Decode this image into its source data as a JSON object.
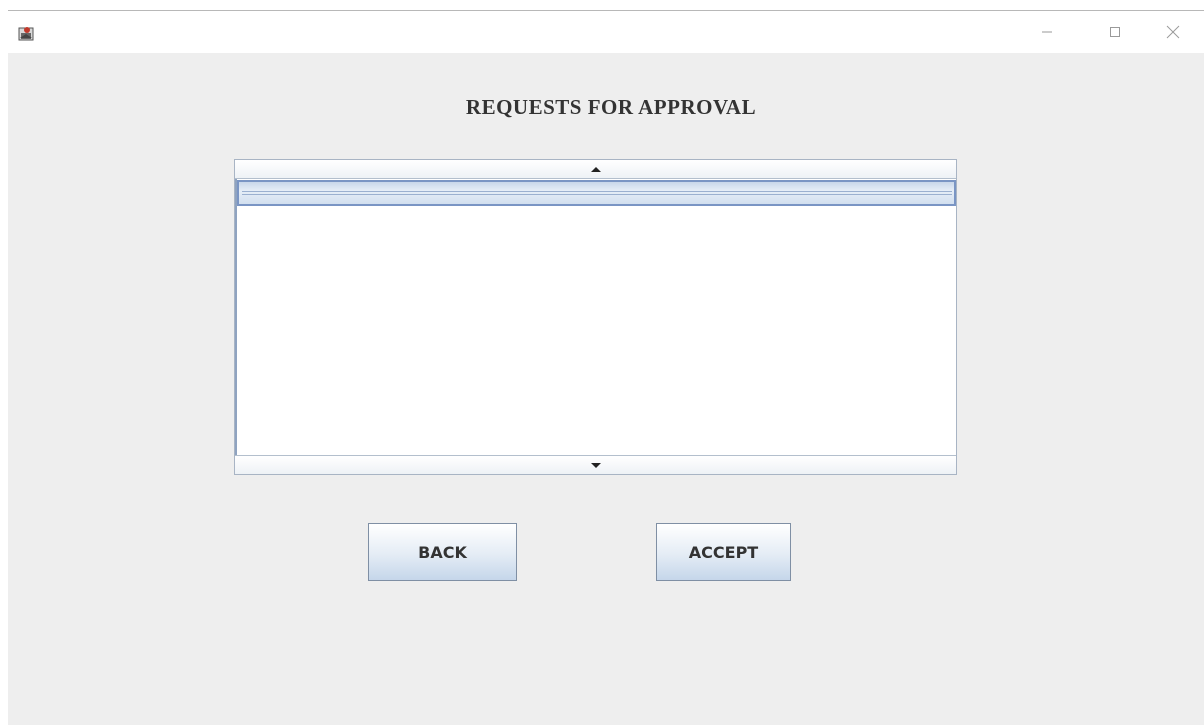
{
  "window": {
    "icon": "java-app-icon",
    "controls": {
      "minimize_glyph": "—",
      "maximize_glyph": "☐",
      "close_glyph": "✕"
    }
  },
  "page": {
    "heading": "REQUESTS FOR APPROVAL"
  },
  "request_list": {
    "items": [
      ""
    ]
  },
  "buttons": {
    "back_label": "BACK",
    "accept_label": "ACCEPT"
  },
  "colors": {
    "background": "#eeeeee",
    "selection": "#c9d7ea",
    "selection_border": "#7a95c4"
  }
}
